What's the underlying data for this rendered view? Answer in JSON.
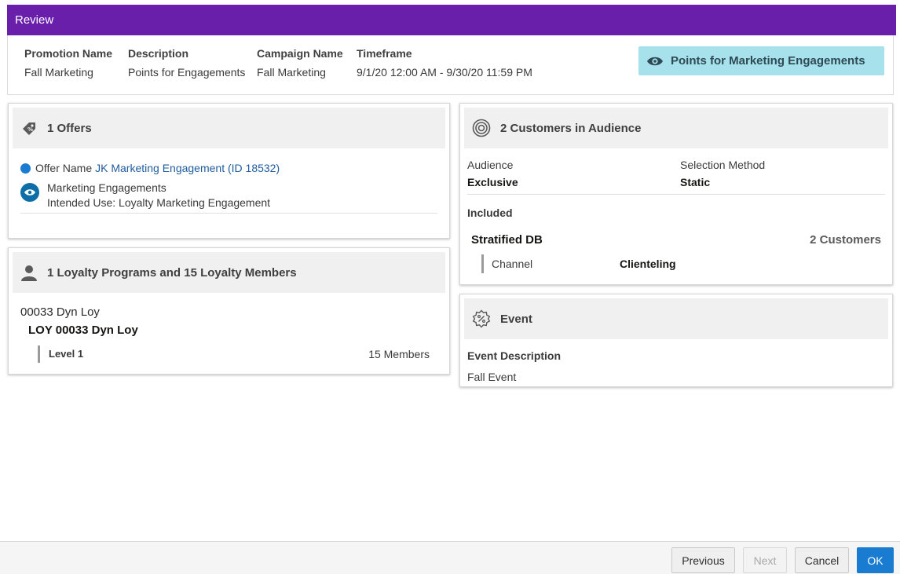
{
  "title": "Review",
  "summary": {
    "promotion_name_label": "Promotion Name",
    "promotion_name": "Fall Marketing",
    "description_label": "Description",
    "description": "Points for Engagements",
    "campaign_name_label": "Campaign Name",
    "campaign_name": "Fall Marketing",
    "timeframe_label": "Timeframe",
    "timeframe": "9/1/20 12:00 AM - 9/30/20 11:59 PM",
    "badge": "Points for Marketing Engagements",
    "badge_icon": "eye-icon"
  },
  "offers": {
    "heading": "1 Offers",
    "icon": "tag-icon",
    "offer_name_label": "Offer Name",
    "offer_name_link": "JK Marketing Engagement (ID 18532)",
    "offer_type": "Marketing Engagements",
    "intended_use": "Intended Use: Loyalty Marketing Engagement"
  },
  "loyalty": {
    "heading": "1 Loyalty Programs and 15 Loyalty Members",
    "icon": "person-icon",
    "program": "00033 Dyn Loy",
    "program_title": "LOY 00033 Dyn Loy",
    "level": "Level 1",
    "members": "15 Members"
  },
  "audience": {
    "heading": "2 Customers in Audience",
    "icon": "target-icon",
    "audience_label": "Audience",
    "audience_value": "Exclusive",
    "selection_label": "Selection Method",
    "selection_value": "Static",
    "included_label": "Included",
    "segment_name": "Stratified DB",
    "segment_count": "2 Customers",
    "channel_label": "Channel",
    "channel_value": "Clienteling"
  },
  "event": {
    "heading": "Event",
    "icon": "percent-badge-icon",
    "description_label": "Event Description",
    "description_value": "Fall Event"
  },
  "footer": {
    "previous": "Previous",
    "next": "Next",
    "cancel": "Cancel",
    "ok": "OK"
  },
  "colors": {
    "title_bar": "#6a1fab",
    "badge_bg": "#a7e1ec",
    "link": "#1f5c9e",
    "primary_button": "#1a7cd0"
  }
}
